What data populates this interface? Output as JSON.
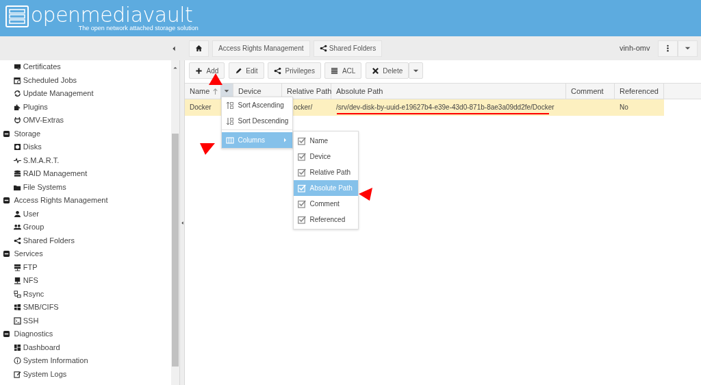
{
  "header": {
    "title": "openmediavault",
    "tagline": "The open network attached storage solution"
  },
  "sidebar": {
    "items": [
      {
        "label": "Certificates"
      },
      {
        "label": "Scheduled Jobs"
      },
      {
        "label": "Update Management"
      },
      {
        "label": "Plugins"
      },
      {
        "label": "OMV-Extras"
      },
      {
        "label": "Storage",
        "expanded": true,
        "children": [
          {
            "label": "Disks"
          },
          {
            "label": "S.M.A.R.T."
          },
          {
            "label": "RAID Management"
          },
          {
            "label": "File Systems"
          }
        ]
      },
      {
        "label": "Access Rights Management",
        "expanded": true,
        "children": [
          {
            "label": "User"
          },
          {
            "label": "Group"
          },
          {
            "label": "Shared Folders"
          }
        ]
      },
      {
        "label": "Services",
        "expanded": true,
        "children": [
          {
            "label": "FTP"
          },
          {
            "label": "NFS"
          },
          {
            "label": "Rsync"
          },
          {
            "label": "SMB/CIFS"
          },
          {
            "label": "SSH"
          }
        ]
      },
      {
        "label": "Diagnostics",
        "expanded": true,
        "children": [
          {
            "label": "Dashboard"
          },
          {
            "label": "System Information"
          },
          {
            "label": "System Logs"
          }
        ]
      }
    ]
  },
  "breadcrumb": [
    {
      "label": "Access Rights Management"
    },
    {
      "label": "Shared Folders"
    }
  ],
  "hostname": "vinh-omv",
  "toolbar": [
    {
      "label": "Add"
    },
    {
      "label": "Edit"
    },
    {
      "label": "Privileges"
    },
    {
      "label": "ACL"
    },
    {
      "label": "Delete",
      "split": true
    }
  ],
  "table": {
    "columns": [
      {
        "label": "Name",
        "sorted": true,
        "menu_open": true
      },
      {
        "label": "Device"
      },
      {
        "label": "Relative Path"
      },
      {
        "label": "Absolute Path"
      },
      {
        "label": "Comment"
      },
      {
        "label": "Referenced"
      }
    ],
    "rows": [
      {
        "selected": true,
        "cells": [
          "Docker",
          null,
          "ocker/",
          "/srv/dev-disk-by-uuid-e19627b4-e39e-43d0-871b-8ae3a09dd2fe/Docker",
          null,
          "No"
        ]
      }
    ]
  },
  "column_menu": {
    "items": [
      {
        "label": "Sort Ascending",
        "kind": "sort-asc",
        "selected": false
      },
      {
        "label": "Sort Descending",
        "kind": "sort-desc",
        "selected": false
      },
      {
        "label": "Columns",
        "kind": "submenu",
        "selected": true
      }
    ],
    "submenu": [
      {
        "label": "Name",
        "checked": true,
        "selected": false
      },
      {
        "label": "Device",
        "checked": true,
        "selected": false
      },
      {
        "label": "Relative Path",
        "checked": true,
        "selected": false
      },
      {
        "label": "Absolute Path",
        "checked": true,
        "selected": true
      },
      {
        "label": "Comment",
        "checked": true,
        "selected": false
      },
      {
        "label": "Referenced",
        "checked": true,
        "selected": false
      }
    ]
  }
}
